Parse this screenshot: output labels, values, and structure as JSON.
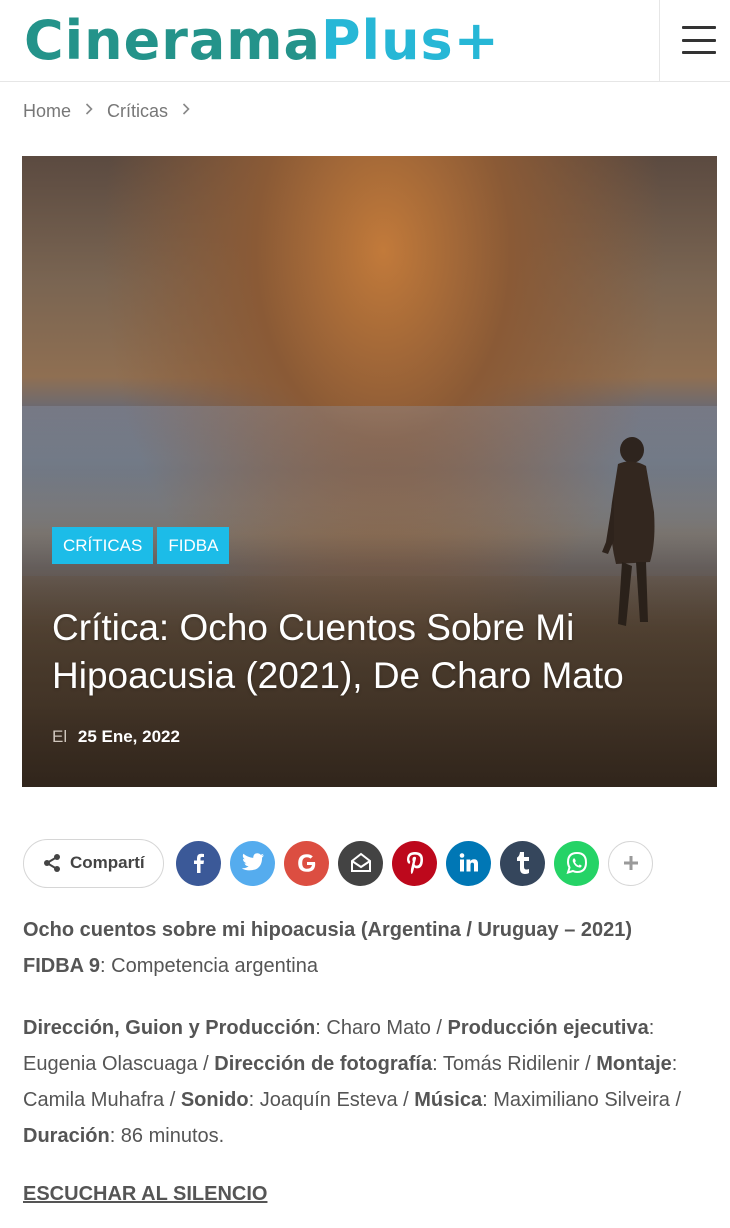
{
  "header": {
    "logo_part1": "Cinerama",
    "logo_part2": "Plus+",
    "menu_icon": "hamburger-menu-icon"
  },
  "breadcrumb": {
    "items": [
      "Home",
      "Críticas"
    ],
    "separator_icon": "chevron-right-icon"
  },
  "hero": {
    "categories": [
      "CRÍTICAS",
      "FIDBA"
    ],
    "title": "Crítica: Ocho Cuentos Sobre Mi Hipoacusia (2021), De Charo Mato",
    "meta_prefix": "El",
    "date": "25 Ene, 2022",
    "accent_color": "#1cbce8"
  },
  "share": {
    "label": "Compartí",
    "buttons": [
      {
        "name": "facebook",
        "glyph": "f",
        "color": "#3b5998"
      },
      {
        "name": "twitter",
        "glyph": "t",
        "color": "#55acee"
      },
      {
        "name": "google",
        "glyph": "G",
        "color": "#dc4e41"
      },
      {
        "name": "email",
        "glyph": "@",
        "color": "#434343"
      },
      {
        "name": "pinterest",
        "glyph": "P",
        "color": "#bd081c"
      },
      {
        "name": "linkedin",
        "glyph": "in",
        "color": "#0077b5"
      },
      {
        "name": "tumblr",
        "glyph": "t",
        "color": "#35465c"
      },
      {
        "name": "whatsapp",
        "glyph": "w",
        "color": "#25d366"
      },
      {
        "name": "more",
        "glyph": "+",
        "color": "#ffffff"
      }
    ]
  },
  "article": {
    "p1_bold": "Ocho cuentos sobre mi hipoacusia (Argentina / Uruguay – 2021)",
    "p1_bold2": "FIDBA 9",
    "p1_rest": ": Competencia argentina",
    "credits": [
      {
        "label": "Dirección, Guion y Producción",
        "value": ": Charo Mato / "
      },
      {
        "label": "Producción ejecutiva",
        "value": ": Eugenia Olascuaga / "
      },
      {
        "label": "Dirección de fotografía",
        "value": ": Tomás Ridilenir / "
      },
      {
        "label": "Montaje",
        "value": ": Camila Muhafra / "
      },
      {
        "label": "Sonido",
        "value": ": Joaquín Esteva / "
      },
      {
        "label": "Música",
        "value": ": Maximiliano Silveira / "
      },
      {
        "label": "Duración",
        "value": ": 86 minutos."
      }
    ],
    "subheading": "ESCUCHAR AL SILENCIO"
  }
}
